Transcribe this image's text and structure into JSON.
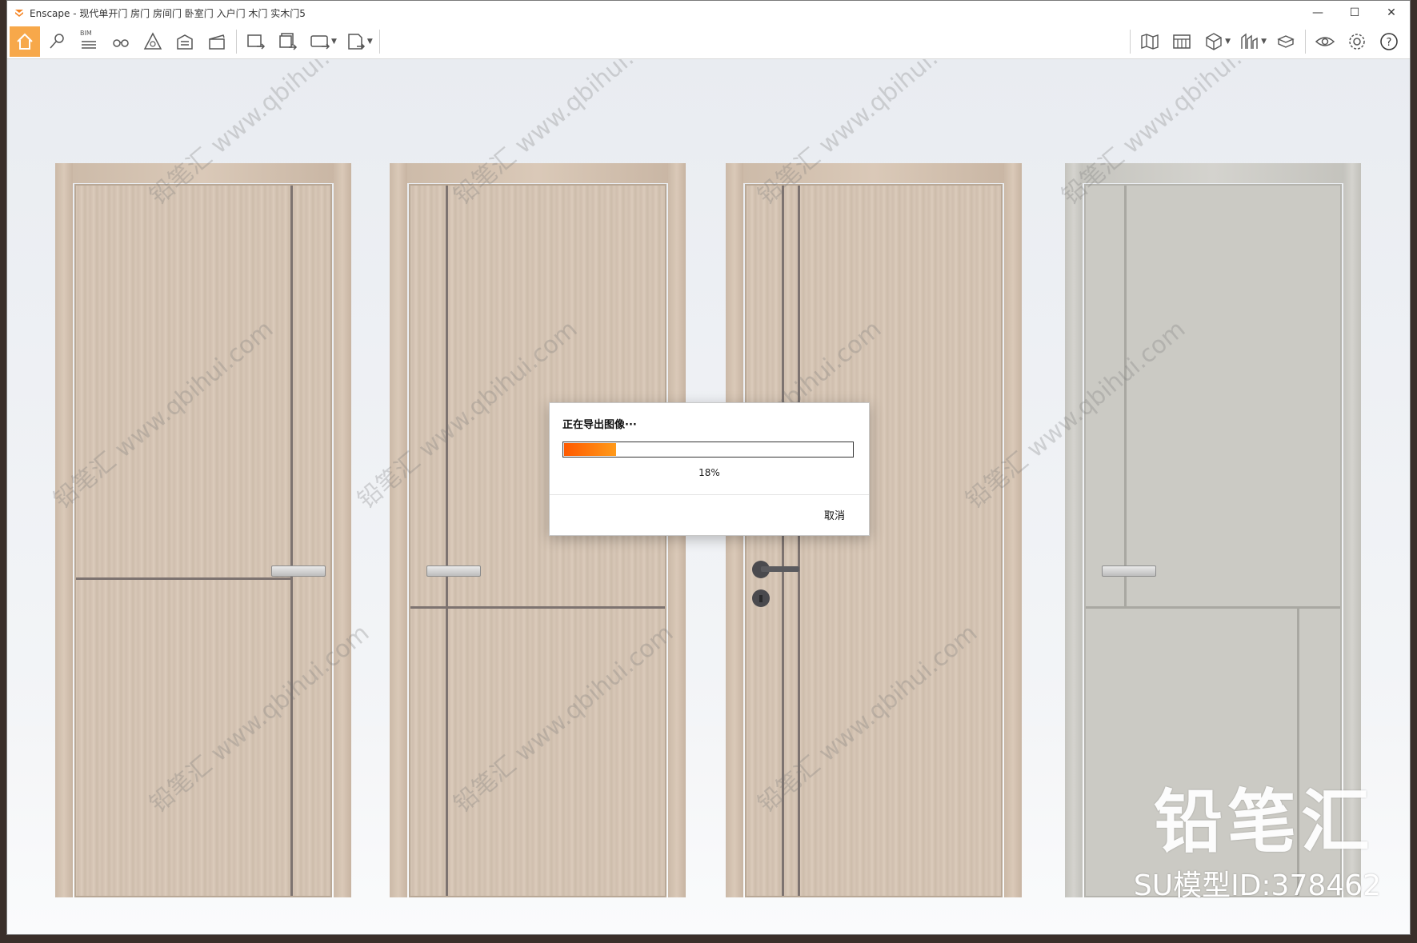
{
  "window": {
    "title": "Enscape - 现代单开门 房门 房间门 卧室门 入户门 木门 实木门5",
    "minimize_icon": "minimize-icon",
    "maximize_icon": "maximize-icon",
    "close_icon": "close-icon"
  },
  "toolbar": {
    "bim_label": "BIM",
    "left_icons": [
      "home-icon",
      "pin-icon",
      "bim-icon",
      "binoculars-icon",
      "perspective-icon",
      "building-icon",
      "clapper-icon",
      "export-image-icon",
      "batch-export-icon",
      "panorama-360-icon",
      "exe-export-icon"
    ],
    "right_icons": [
      "map-icon",
      "grid-panel-icon",
      "cube-icon",
      "chart-icon",
      "asset-library-icon",
      "eye-icon",
      "settings-icon",
      "help-icon"
    ],
    "accent_color": "#f7a84a"
  },
  "dialog": {
    "title": "正在导出图像···",
    "progress": 18,
    "progress_text": "18%",
    "cancel_label": "取消"
  },
  "watermark": {
    "logo_text": "铅笔汇",
    "id_text": "SU模型ID:378462",
    "tile_text": "铅笔汇 www.qbihui.com"
  }
}
